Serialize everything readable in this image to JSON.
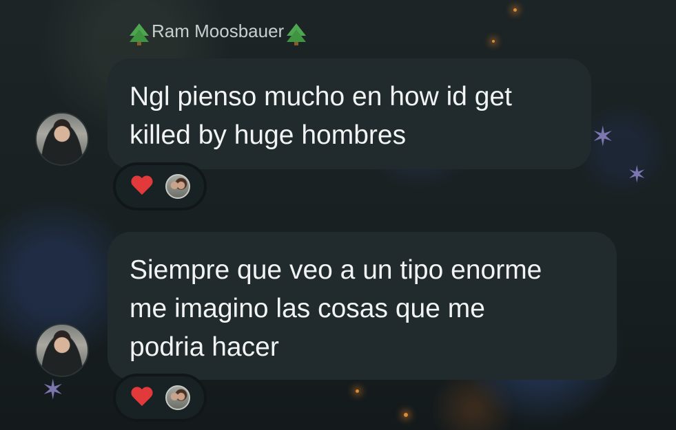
{
  "sender": {
    "name": "Ram Moosbauer",
    "icon_left": "evergreen-tree-icon",
    "icon_right": "evergreen-tree-icon"
  },
  "messages": [
    {
      "lines": [
        "Ngl pienso mucho en how id get",
        "killed by huge hombres"
      ],
      "reaction": {
        "emoji": "red-heart-icon",
        "count_avatars": 1
      }
    },
    {
      "lines": [
        "Siempre que veo a un tipo enorme",
        "me imagino las cosas que me",
        "podria hacer"
      ],
      "reaction": {
        "emoji": "red-heart-icon",
        "count_avatars": 1
      }
    }
  ],
  "colors": {
    "bubble": "#212b2d",
    "text": "#f2f4f4",
    "sender_name": "#c9cfcf",
    "heart": "#e23a3a",
    "background": "#1b2224"
  }
}
